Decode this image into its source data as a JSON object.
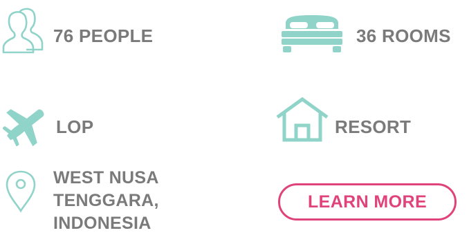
{
  "colors": {
    "icon_teal": "#8fd3c9",
    "text_gray": "#7a7a7a",
    "accent_pink": "#e0427a"
  },
  "features": {
    "people": {
      "icon": "people-icon",
      "label": "76 PEOPLE"
    },
    "rooms": {
      "icon": "bed-icon",
      "label": "36 ROOMS"
    },
    "airport": {
      "icon": "airplane-icon",
      "label": "LOP"
    },
    "type": {
      "icon": "house-icon",
      "label": "RESORT"
    },
    "location": {
      "icon": "map-pin-icon",
      "lines": [
        "WEST NUSA",
        "TENGGARA,",
        "INDONESIA"
      ]
    }
  },
  "cta": {
    "label": "LEARN MORE"
  }
}
